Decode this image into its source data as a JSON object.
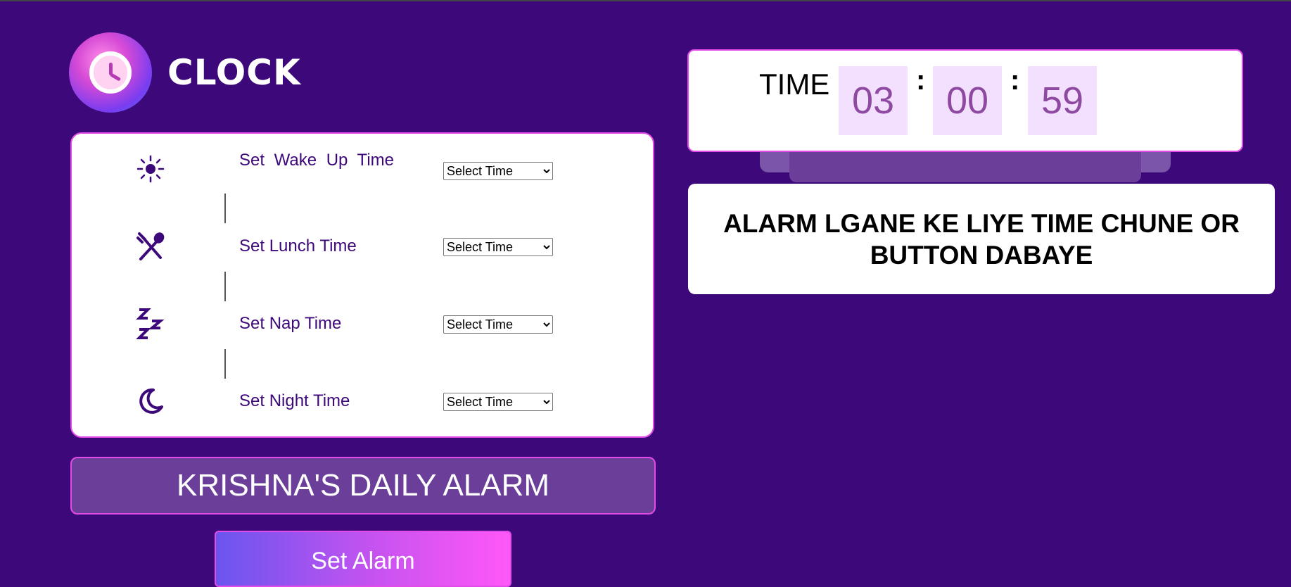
{
  "logo": {
    "text": "CLOCK",
    "icon": "alarm-clock-icon"
  },
  "schedule": [
    {
      "icon": "sun-icon",
      "label": "Set Wake Up Time",
      "select": {
        "selected": "Select Time"
      }
    },
    {
      "icon": "fork-spoon-icon",
      "label": "Set Lunch Time",
      "select": {
        "selected": "Select Time"
      }
    },
    {
      "icon": "sleep-zzz-icon",
      "label": "Set Nap Time",
      "select": {
        "selected": "Select Time"
      }
    },
    {
      "icon": "moon-icon",
      "label": "Set Night Time",
      "select": {
        "selected": "Select Time"
      }
    }
  ],
  "banner": {
    "text": "KRISHNA'S DAILY ALARM"
  },
  "set_alarm_button": {
    "label": "Set Alarm"
  },
  "clock": {
    "label": "TIME",
    "hours": "03",
    "minutes": "00",
    "seconds": "59",
    "separator": ":"
  },
  "message": {
    "text": "ALARM LGANE KE LIYE TIME CHUNE OR BUTTON DABAYE"
  },
  "colors": {
    "background": "#3d087a",
    "accent_border": "#e34be8",
    "label_text": "#3d087a",
    "digit_box": "#f3e0ff",
    "digit_text": "#8e4aa0",
    "banner": "#6b3e9a"
  }
}
